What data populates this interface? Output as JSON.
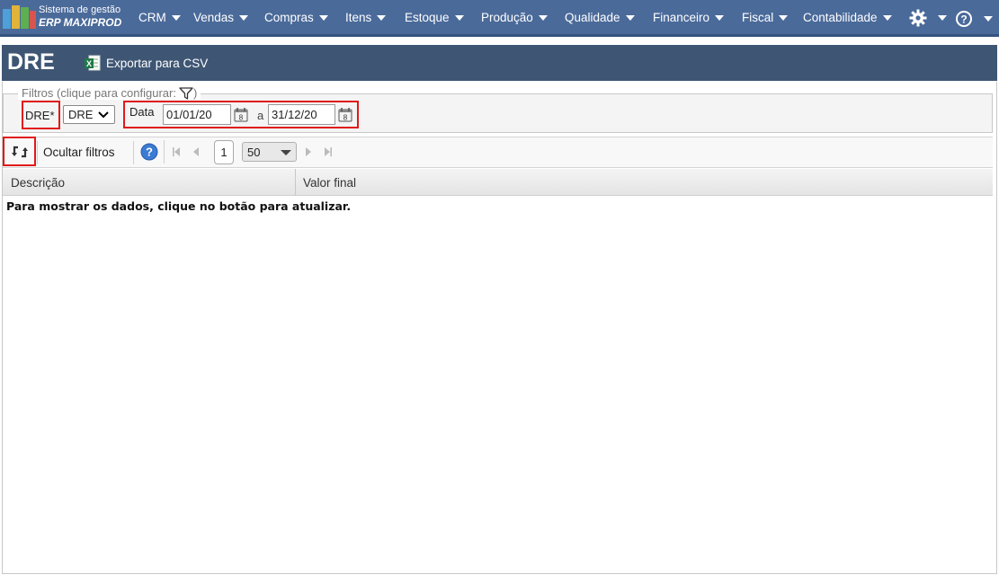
{
  "brand": {
    "line1": "Sistema de gestão",
    "line2": "ERP MAXIPROD"
  },
  "nav": {
    "menus": [
      "CRM",
      "Vendas",
      "Compras",
      "Itens",
      "Estoque",
      "Produção",
      "Qualidade",
      "Financeiro",
      "Fiscal",
      "Contabilidade"
    ],
    "icons": [
      "gear-icon",
      "help-icon"
    ]
  },
  "page": {
    "title": "DRE",
    "export_label": "Exportar para CSV"
  },
  "filters": {
    "legend": "Filtros (clique para configurar:",
    "legend_end": ")",
    "dre_label": "DRE*",
    "dre_value": "DRE",
    "date_label": "Data",
    "date_from": "01/01/20",
    "date_sep": "a",
    "date_to": "31/12/20"
  },
  "toolbar": {
    "hide_filters": "Ocultar filtros",
    "page_number": "1",
    "page_size": "50"
  },
  "grid": {
    "columns": [
      "Descrição",
      "Valor final"
    ],
    "empty_message": "Para mostrar os dados, clique no botão para atualizar."
  },
  "colors": {
    "nav_bg": "#4a6a9a",
    "title_bg": "#3e5674",
    "highlight": "#e01a1a",
    "help_blue": "#3b7bd4"
  }
}
